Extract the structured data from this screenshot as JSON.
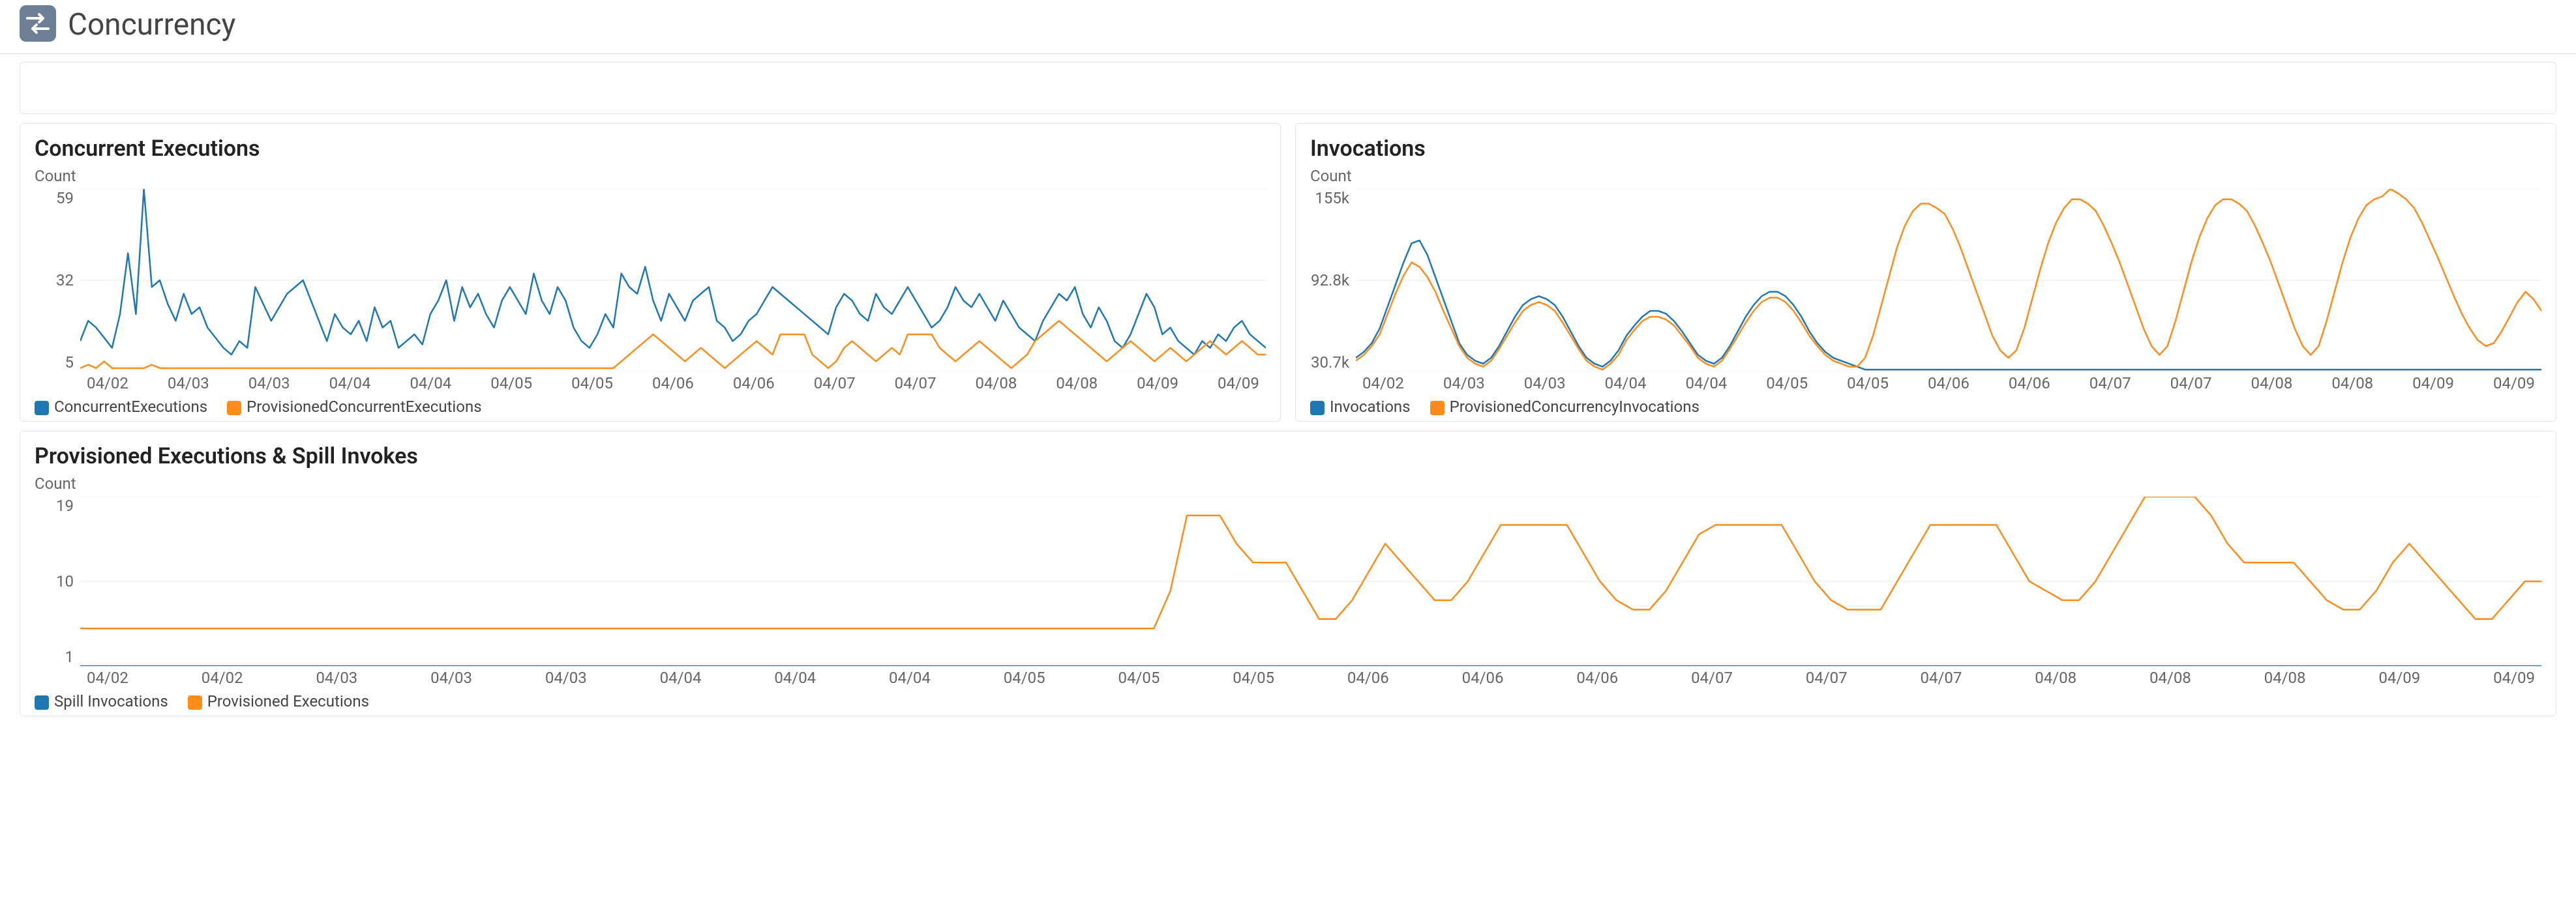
{
  "header": {
    "title": "Concurrency"
  },
  "colors": {
    "blue": "#1f77b4",
    "orange": "#ff8c1a"
  },
  "chart_data": [
    {
      "id": "concurrent-executions",
      "type": "line",
      "title": "Concurrent Executions",
      "ylabel": "Count",
      "ylim": [
        5,
        59
      ],
      "yticks": [
        59,
        32,
        5
      ],
      "categories": [
        "04/02",
        "04/03",
        "04/03",
        "04/04",
        "04/04",
        "04/05",
        "04/05",
        "04/06",
        "04/06",
        "04/07",
        "04/07",
        "04/08",
        "04/08",
        "04/09",
        "04/09"
      ],
      "series": [
        {
          "name": "ConcurrentExecutions",
          "color": "blue",
          "values": [
            14,
            20,
            18,
            15,
            12,
            22,
            40,
            22,
            59,
            30,
            32,
            25,
            20,
            28,
            22,
            24,
            18,
            15,
            12,
            10,
            14,
            12,
            30,
            25,
            20,
            24,
            28,
            30,
            32,
            26,
            20,
            14,
            22,
            18,
            16,
            20,
            14,
            24,
            18,
            20,
            12,
            14,
            16,
            13,
            22,
            26,
            32,
            20,
            30,
            24,
            28,
            22,
            18,
            26,
            30,
            26,
            22,
            34,
            26,
            22,
            30,
            26,
            18,
            14,
            12,
            16,
            22,
            18,
            34,
            30,
            28,
            36,
            26,
            20,
            28,
            24,
            20,
            26,
            28,
            30,
            20,
            18,
            14,
            16,
            20,
            22,
            26,
            30,
            28,
            26,
            24,
            22,
            20,
            18,
            16,
            24,
            28,
            26,
            22,
            20,
            28,
            24,
            22,
            26,
            30,
            26,
            22,
            18,
            20,
            24,
            30,
            26,
            24,
            28,
            24,
            20,
            26,
            22,
            18,
            16,
            14,
            20,
            24,
            28,
            26,
            30,
            22,
            18,
            24,
            20,
            14,
            12,
            16,
            22,
            28,
            24,
            16,
            18,
            14,
            12,
            10,
            14,
            12,
            16,
            14,
            18,
            20,
            16,
            14,
            12
          ]
        },
        {
          "name": "ProvisionedConcurrentExecutions",
          "color": "orange",
          "values": [
            6,
            7,
            6,
            8,
            6,
            6,
            6,
            6,
            6,
            7,
            6,
            6,
            6,
            6,
            6,
            6,
            6,
            6,
            6,
            6,
            6,
            6,
            6,
            6,
            6,
            6,
            6,
            6,
            6,
            6,
            6,
            6,
            6,
            6,
            6,
            6,
            6,
            6,
            6,
            6,
            6,
            6,
            6,
            6,
            6,
            6,
            6,
            6,
            6,
            6,
            6,
            6,
            6,
            6,
            6,
            6,
            6,
            6,
            6,
            6,
            6,
            6,
            6,
            6,
            6,
            6,
            6,
            6,
            8,
            10,
            12,
            14,
            16,
            14,
            12,
            10,
            8,
            10,
            12,
            10,
            8,
            6,
            8,
            10,
            12,
            14,
            12,
            10,
            16,
            16,
            16,
            16,
            10,
            8,
            6,
            8,
            12,
            14,
            12,
            10,
            8,
            10,
            12,
            10,
            16,
            16,
            16,
            16,
            12,
            10,
            8,
            10,
            12,
            14,
            12,
            10,
            8,
            6,
            8,
            10,
            14,
            16,
            18,
            20,
            18,
            16,
            14,
            12,
            10,
            8,
            10,
            12,
            14,
            12,
            10,
            8,
            10,
            12,
            10,
            8,
            10,
            12,
            14,
            12,
            10,
            12,
            14,
            12,
            10,
            10
          ]
        }
      ]
    },
    {
      "id": "invocations",
      "type": "line",
      "title": "Invocations",
      "ylabel": "Count",
      "ylim": [
        30700,
        155000
      ],
      "yticks": [
        "155k",
        "92.8k",
        "30.7k"
      ],
      "categories": [
        "04/02",
        "04/03",
        "04/03",
        "04/04",
        "04/04",
        "04/05",
        "04/05",
        "04/06",
        "04/06",
        "04/07",
        "04/07",
        "04/08",
        "04/08",
        "04/09",
        "04/09"
      ],
      "series": [
        {
          "name": "Invocations",
          "color": "blue",
          "values": [
            40000,
            44000,
            50000,
            60000,
            75000,
            90000,
            105000,
            118000,
            120000,
            110000,
            95000,
            80000,
            65000,
            50000,
            42000,
            38000,
            36000,
            40000,
            48000,
            58000,
            68000,
            76000,
            80000,
            82000,
            80000,
            76000,
            68000,
            58000,
            48000,
            40000,
            36000,
            34000,
            38000,
            45000,
            55000,
            62000,
            68000,
            72000,
            72000,
            70000,
            65000,
            58000,
            50000,
            42000,
            38000,
            36000,
            40000,
            48000,
            58000,
            68000,
            76000,
            82000,
            85000,
            85000,
            82000,
            76000,
            68000,
            58000,
            50000,
            44000,
            40000,
            38000,
            36000,
            34000,
            32000,
            32000,
            32000,
            32000,
            32000,
            32000,
            32000,
            32000,
            32000,
            32000,
            32000,
            32000,
            32000,
            32000,
            32000,
            32000,
            32000,
            32000,
            32000,
            32000,
            32000,
            32000,
            32000,
            32000,
            32000,
            32000,
            32000,
            32000,
            32000,
            32000,
            32000,
            32000,
            32000,
            32000,
            32000,
            32000,
            32000,
            32000,
            32000,
            32000,
            32000,
            32000,
            32000,
            32000,
            32000,
            32000,
            32000,
            32000,
            32000,
            32000,
            32000,
            32000,
            32000,
            32000,
            32000,
            32000,
            32000,
            32000,
            32000,
            32000,
            32000,
            32000,
            32000,
            32000,
            32000,
            32000,
            32000,
            32000,
            32000,
            32000,
            32000,
            32000,
            32000,
            32000,
            32000,
            32000,
            32000,
            32000,
            32000,
            32000,
            32000,
            32000,
            32000,
            32000,
            32000,
            32000
          ]
        },
        {
          "name": "ProvisionedConcurrencyInvocations",
          "color": "orange",
          "values": [
            38000,
            42000,
            48000,
            56000,
            70000,
            84000,
            96000,
            105000,
            102000,
            95000,
            85000,
            72000,
            60000,
            48000,
            40000,
            36000,
            34000,
            38000,
            46000,
            55000,
            64000,
            72000,
            76000,
            78000,
            76000,
            72000,
            64000,
            55000,
            46000,
            38000,
            34000,
            32000,
            36000,
            42000,
            52000,
            59000,
            65000,
            68000,
            68000,
            66000,
            62000,
            55000,
            48000,
            40000,
            36000,
            34000,
            38000,
            46000,
            55000,
            64000,
            72000,
            78000,
            81000,
            81000,
            78000,
            72000,
            64000,
            55000,
            48000,
            42000,
            38000,
            36000,
            34000,
            34000,
            40000,
            55000,
            75000,
            95000,
            115000,
            130000,
            140000,
            145000,
            145000,
            142000,
            138000,
            128000,
            115000,
            100000,
            85000,
            70000,
            55000,
            45000,
            40000,
            45000,
            60000,
            80000,
            100000,
            118000,
            132000,
            142000,
            148000,
            148000,
            145000,
            140000,
            130000,
            118000,
            105000,
            90000,
            75000,
            60000,
            48000,
            42000,
            48000,
            65000,
            85000,
            105000,
            122000,
            135000,
            144000,
            148000,
            148000,
            145000,
            140000,
            130000,
            118000,
            105000,
            90000,
            75000,
            60000,
            48000,
            42000,
            48000,
            65000,
            85000,
            105000,
            122000,
            135000,
            144000,
            148000,
            150000,
            155000,
            152000,
            148000,
            142000,
            132000,
            120000,
            108000,
            95000,
            82000,
            70000,
            60000,
            52000,
            48000,
            50000,
            58000,
            68000,
            78000,
            85000,
            80000,
            72000
          ]
        }
      ]
    },
    {
      "id": "provisioned-spill",
      "type": "line",
      "title": "Provisioned Executions & Spill Invokes",
      "ylabel": "Count",
      "ylim": [
        1,
        19
      ],
      "yticks": [
        19,
        10,
        1
      ],
      "categories": [
        "04/02",
        "04/02",
        "04/03",
        "04/03",
        "04/03",
        "04/04",
        "04/04",
        "04/04",
        "04/05",
        "04/05",
        "04/05",
        "04/06",
        "04/06",
        "04/06",
        "04/07",
        "04/07",
        "04/07",
        "04/08",
        "04/08",
        "04/08",
        "04/09",
        "04/09"
      ],
      "series": [
        {
          "name": "Spill Invocations",
          "color": "blue",
          "values": [
            1,
            1,
            1,
            1,
            1,
            1,
            1,
            1,
            1,
            1,
            1,
            1,
            1,
            1,
            1,
            1,
            1,
            1,
            1,
            1,
            1,
            1,
            1,
            1,
            1,
            1,
            1,
            1,
            1,
            1,
            1,
            1,
            1,
            1,
            1,
            1,
            1,
            1,
            1,
            1,
            1,
            1,
            1,
            1,
            1,
            1,
            1,
            1,
            1,
            1,
            1,
            1,
            1,
            1,
            1,
            1,
            1,
            1,
            1,
            1,
            1,
            1,
            1,
            1,
            1,
            1,
            1,
            1,
            1,
            1,
            1,
            1,
            1,
            1,
            1,
            1,
            1,
            1,
            1,
            1,
            1,
            1,
            1,
            1,
            1,
            1,
            1,
            1,
            1,
            1,
            1,
            1,
            1,
            1,
            1,
            1,
            1,
            1,
            1,
            1,
            1,
            1,
            1,
            1,
            1,
            1,
            1,
            1,
            1,
            1,
            1,
            1,
            1,
            1,
            1,
            1,
            1,
            1,
            1,
            1,
            1,
            1,
            1,
            1,
            1,
            1,
            1,
            1,
            1,
            1,
            1,
            1,
            1,
            1,
            1,
            1,
            1,
            1,
            1,
            1,
            1,
            1,
            1,
            1,
            1,
            1,
            1,
            1,
            1,
            1
          ]
        },
        {
          "name": "Provisioned Executions",
          "color": "orange",
          "values": [
            5,
            5,
            5,
            5,
            5,
            5,
            5,
            5,
            5,
            5,
            5,
            5,
            5,
            5,
            5,
            5,
            5,
            5,
            5,
            5,
            5,
            5,
            5,
            5,
            5,
            5,
            5,
            5,
            5,
            5,
            5,
            5,
            5,
            5,
            5,
            5,
            5,
            5,
            5,
            5,
            5,
            5,
            5,
            5,
            5,
            5,
            5,
            5,
            5,
            5,
            5,
            5,
            5,
            5,
            5,
            5,
            5,
            5,
            5,
            5,
            5,
            5,
            5,
            5,
            5,
            5,
            9,
            17,
            17,
            17,
            14,
            12,
            12,
            12,
            9,
            6,
            6,
            8,
            11,
            14,
            12,
            10,
            8,
            8,
            10,
            13,
            16,
            16,
            16,
            16,
            16,
            13,
            10,
            8,
            7,
            7,
            9,
            12,
            15,
            16,
            16,
            16,
            16,
            16,
            13,
            10,
            8,
            7,
            7,
            7,
            10,
            13,
            16,
            16,
            16,
            16,
            16,
            13,
            10,
            9,
            8,
            8,
            10,
            13,
            16,
            19,
            19,
            19,
            19,
            17,
            14,
            12,
            12,
            12,
            12,
            10,
            8,
            7,
            7,
            9,
            12,
            14,
            12,
            10,
            8,
            6,
            6,
            8,
            10,
            10
          ]
        }
      ]
    }
  ]
}
